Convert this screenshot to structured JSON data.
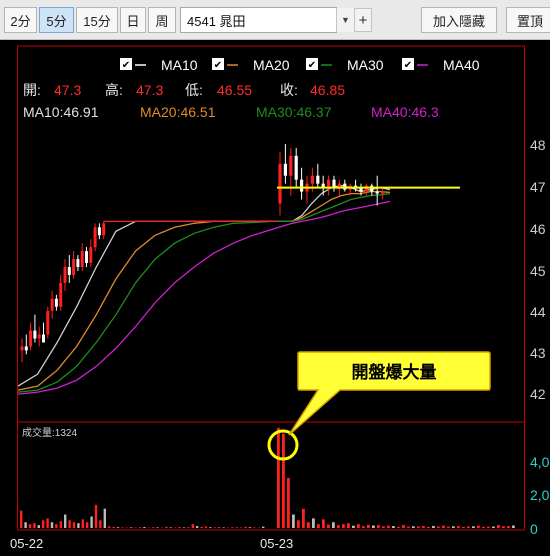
{
  "toolbar": {
    "periods": [
      "2分",
      "5分",
      "15分",
      "日",
      "周"
    ],
    "active_period": "5分",
    "symbol_value": "4541 晁田",
    "hide_button": "加入隱藏",
    "top_button": "置頂"
  },
  "legend": {
    "items": [
      {
        "label": "MA10",
        "color": "#ffffff"
      },
      {
        "label": "MA20",
        "color": "#e08a2a"
      },
      {
        "label": "MA30",
        "color": "#1e8c1e"
      },
      {
        "label": "MA40",
        "color": "#d020d0"
      }
    ]
  },
  "ohlc": {
    "open_label": "開:",
    "open_value": "47.3",
    "high_label": "高:",
    "high_value": "47.3",
    "low_label": "低:",
    "low_value": "46.55",
    "close_label": "收:",
    "close_value": "46.85"
  },
  "ma_values": {
    "ma10": "MA10:46.91",
    "ma20": "MA20:46.51",
    "ma30": "MA30:46.37",
    "ma40": "MA40:46.3"
  },
  "price_axis_labels": [
    "48",
    "47",
    "46",
    "45",
    "44",
    "43",
    "42"
  ],
  "volume_label": "成交量:1324",
  "volume_axis_labels": [
    "4,0",
    "2,0",
    "0"
  ],
  "date_labels": [
    "05-22",
    "05-23"
  ],
  "callout_text": "開盤爆大量",
  "colors": {
    "up": "#ff2020",
    "down": "#ffffff",
    "highlight_line": "#ffff00",
    "callout_bg": "#ffff33",
    "axis_text": "#cfcfcf",
    "volume_axis_text": "#2fd0d0",
    "frame": "#c00000"
  },
  "chart_data": {
    "type": "candlestick",
    "price_ylim": [
      41.6,
      48.3
    ],
    "reference_line_price": 47.0,
    "volume_ylim": [
      0,
      5400
    ],
    "day1_candles": [
      {
        "o": 42.9,
        "h": 43.2,
        "l": 42.6,
        "c": 43.0
      },
      {
        "o": 43.0,
        "h": 43.3,
        "l": 42.8,
        "c": 42.9
      },
      {
        "o": 43.0,
        "h": 43.6,
        "l": 42.9,
        "c": 43.4
      },
      {
        "o": 43.4,
        "h": 43.8,
        "l": 43.1,
        "c": 43.2
      },
      {
        "o": 43.2,
        "h": 43.5,
        "l": 43.0,
        "c": 43.3
      },
      {
        "o": 43.3,
        "h": 43.6,
        "l": 43.1,
        "c": 43.1
      },
      {
        "o": 43.3,
        "h": 44.0,
        "l": 43.2,
        "c": 43.9
      },
      {
        "o": 43.9,
        "h": 44.4,
        "l": 43.7,
        "c": 44.2
      },
      {
        "o": 44.2,
        "h": 44.3,
        "l": 43.9,
        "c": 44.0
      },
      {
        "o": 44.0,
        "h": 44.8,
        "l": 43.9,
        "c": 44.6
      },
      {
        "o": 44.6,
        "h": 45.2,
        "l": 44.4,
        "c": 45.0
      },
      {
        "o": 45.0,
        "h": 45.3,
        "l": 44.6,
        "c": 44.8
      },
      {
        "o": 44.8,
        "h": 45.4,
        "l": 44.7,
        "c": 45.2
      },
      {
        "o": 45.2,
        "h": 45.3,
        "l": 44.9,
        "c": 45.0
      },
      {
        "o": 45.0,
        "h": 45.6,
        "l": 44.9,
        "c": 45.4
      },
      {
        "o": 45.4,
        "h": 45.5,
        "l": 45.0,
        "c": 45.1
      },
      {
        "o": 45.1,
        "h": 45.7,
        "l": 45.0,
        "c": 45.5
      },
      {
        "o": 45.5,
        "h": 46.1,
        "l": 45.4,
        "c": 46.0
      },
      {
        "o": 46.0,
        "h": 46.1,
        "l": 45.7,
        "c": 45.8
      },
      {
        "o": 45.8,
        "h": 46.15,
        "l": 45.7,
        "c": 46.1
      }
    ],
    "limit_up_price": 46.15,
    "day2_candles": [
      {
        "o": 46.6,
        "h": 47.9,
        "l": 46.3,
        "c": 47.6
      },
      {
        "o": 47.6,
        "h": 48.1,
        "l": 47.1,
        "c": 47.3
      },
      {
        "o": 47.3,
        "h": 48.0,
        "l": 46.8,
        "c": 47.8
      },
      {
        "o": 47.8,
        "h": 48.0,
        "l": 47.0,
        "c": 47.2
      },
      {
        "o": 47.2,
        "h": 47.5,
        "l": 46.7,
        "c": 46.9
      },
      {
        "o": 46.9,
        "h": 47.3,
        "l": 46.6,
        "c": 47.1
      },
      {
        "o": 47.1,
        "h": 47.5,
        "l": 46.9,
        "c": 47.3
      },
      {
        "o": 47.3,
        "h": 47.6,
        "l": 47.0,
        "c": 47.1
      },
      {
        "o": 47.1,
        "h": 47.3,
        "l": 46.8,
        "c": 47.0
      },
      {
        "o": 47.0,
        "h": 47.3,
        "l": 46.8,
        "c": 47.2
      },
      {
        "o": 47.2,
        "h": 47.3,
        "l": 46.9,
        "c": 47.0
      },
      {
        "o": 47.0,
        "h": 47.2,
        "l": 46.8,
        "c": 47.1
      },
      {
        "o": 47.1,
        "h": 47.2,
        "l": 46.9,
        "c": 46.95
      },
      {
        "o": 46.95,
        "h": 47.1,
        "l": 46.8,
        "c": 47.05
      },
      {
        "o": 47.05,
        "h": 47.2,
        "l": 46.9,
        "c": 47.0
      },
      {
        "o": 47.0,
        "h": 47.1,
        "l": 46.8,
        "c": 46.9
      },
      {
        "o": 46.9,
        "h": 47.1,
        "l": 46.8,
        "c": 47.05
      },
      {
        "o": 47.05,
        "h": 47.1,
        "l": 46.8,
        "c": 46.9
      },
      {
        "o": 46.9,
        "h": 47.3,
        "l": 46.55,
        "c": 46.85
      },
      {
        "o": 46.85,
        "h": 47.0,
        "l": 46.7,
        "c": 46.9
      }
    ],
    "day1_volumes": [
      900,
      300,
      200,
      250,
      150,
      400,
      500,
      300,
      200,
      350,
      700,
      400,
      300,
      250,
      450,
      300,
      600,
      1200,
      400,
      1000,
      80,
      60,
      40,
      30,
      20,
      30,
      20,
      40,
      50,
      20,
      40,
      30,
      20,
      60,
      30,
      20,
      50,
      30,
      40,
      200,
      100,
      60,
      80,
      40,
      30,
      50,
      30,
      20,
      40,
      20,
      30,
      60,
      40,
      30,
      20,
      70
    ],
    "day2_volumes": [
      5200,
      4900,
      2600,
      700,
      400,
      1000,
      300,
      500,
      200,
      450,
      180,
      300,
      150,
      200,
      250,
      120,
      200,
      100,
      160,
      130,
      150,
      90,
      120,
      100,
      60,
      150,
      70,
      90,
      80,
      100,
      60,
      110,
      80,
      120,
      70,
      90,
      100,
      60,
      80,
      90,
      120,
      60,
      70,
      80,
      160,
      90,
      100,
      130
    ],
    "ma_curves": {
      "ma10": [
        [
          0,
          42.0
        ],
        [
          4,
          42.3
        ],
        [
          8,
          43.1
        ],
        [
          12,
          44.0
        ],
        [
          16,
          45.0
        ],
        [
          20,
          45.9
        ],
        [
          24,
          46.15
        ],
        [
          28,
          46.15
        ],
        [
          32,
          46.15
        ],
        [
          36,
          46.15
        ],
        [
          40,
          46.15
        ],
        [
          44,
          46.15
        ],
        [
          48,
          46.15
        ],
        [
          52,
          46.15
        ],
        [
          56,
          46.15
        ],
        [
          58,
          46.3
        ],
        [
          60,
          46.6
        ],
        [
          62,
          46.85
        ],
        [
          64,
          47.0
        ],
        [
          66,
          47.05
        ],
        [
          68,
          47.0
        ],
        [
          70,
          46.9
        ],
        [
          72,
          46.95
        ],
        [
          74,
          47.0
        ],
        [
          76,
          46.95
        ]
      ],
      "ma20": [
        [
          0,
          41.9
        ],
        [
          4,
          42.0
        ],
        [
          8,
          42.4
        ],
        [
          12,
          43.0
        ],
        [
          16,
          43.8
        ],
        [
          20,
          44.7
        ],
        [
          24,
          45.4
        ],
        [
          28,
          45.8
        ],
        [
          32,
          46.0
        ],
        [
          36,
          46.1
        ],
        [
          40,
          46.15
        ],
        [
          44,
          46.15
        ],
        [
          48,
          46.15
        ],
        [
          52,
          46.15
        ],
        [
          56,
          46.15
        ],
        [
          58,
          46.25
        ],
        [
          60,
          46.4
        ],
        [
          62,
          46.55
        ],
        [
          64,
          46.7
        ],
        [
          66,
          46.8
        ],
        [
          68,
          46.85
        ],
        [
          70,
          46.85
        ],
        [
          72,
          46.9
        ],
        [
          74,
          46.9
        ],
        [
          76,
          46.88
        ]
      ],
      "ma30": [
        [
          0,
          41.85
        ],
        [
          4,
          41.9
        ],
        [
          8,
          42.1
        ],
        [
          12,
          42.5
        ],
        [
          16,
          43.1
        ],
        [
          20,
          43.8
        ],
        [
          24,
          44.6
        ],
        [
          28,
          45.2
        ],
        [
          32,
          45.6
        ],
        [
          36,
          45.85
        ],
        [
          40,
          46.0
        ],
        [
          44,
          46.1
        ],
        [
          48,
          46.12
        ],
        [
          52,
          46.15
        ],
        [
          56,
          46.15
        ],
        [
          58,
          46.2
        ],
        [
          60,
          46.3
        ],
        [
          62,
          46.4
        ],
        [
          64,
          46.5
        ],
        [
          66,
          46.6
        ],
        [
          68,
          46.7
        ],
        [
          70,
          46.75
        ],
        [
          72,
          46.8
        ],
        [
          74,
          46.82
        ],
        [
          76,
          46.85
        ]
      ],
      "ma40": [
        [
          0,
          41.8
        ],
        [
          4,
          41.85
        ],
        [
          8,
          41.95
        ],
        [
          12,
          42.15
        ],
        [
          16,
          42.5
        ],
        [
          20,
          42.95
        ],
        [
          24,
          43.5
        ],
        [
          28,
          44.1
        ],
        [
          32,
          44.6
        ],
        [
          36,
          45.0
        ],
        [
          40,
          45.35
        ],
        [
          44,
          45.6
        ],
        [
          48,
          45.8
        ],
        [
          52,
          45.95
        ],
        [
          56,
          46.1
        ],
        [
          58,
          46.15
        ],
        [
          60,
          46.2
        ],
        [
          62,
          46.25
        ],
        [
          64,
          46.32
        ],
        [
          66,
          46.4
        ],
        [
          68,
          46.45
        ],
        [
          70,
          46.5
        ],
        [
          72,
          46.55
        ],
        [
          74,
          46.6
        ],
        [
          76,
          46.65
        ]
      ]
    }
  }
}
